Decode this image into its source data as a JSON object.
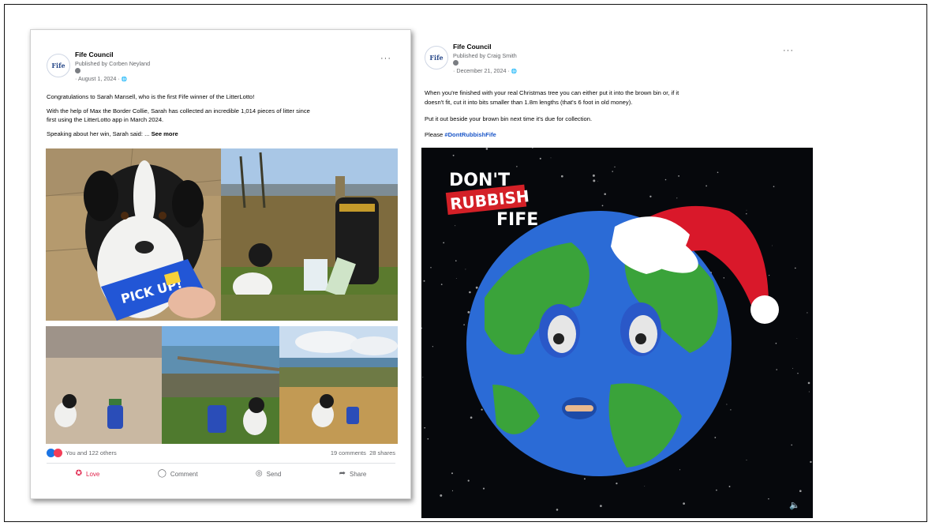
{
  "post1": {
    "page_name": "Fife Council",
    "logo_text": "Fife",
    "published_by": "Published by Corben Neyland",
    "date": "· August 1, 2024 · ",
    "globe_glyph": "🌐",
    "more_glyph": "···",
    "line1": "Congratulations to Sarah Mansell, who is the first Fife winner of the LitterLotto!",
    "line2a": "With the help of Max the Border Collie, Sarah has collected an incredible 1,014 pieces of litter since",
    "line2b": "first using the LitterLotto app in March 2024.",
    "line3": "Speaking about her win, Sarah said: ... ",
    "see_more": "See more",
    "packet_text": "PICK UP!",
    "reactions_text": "You and 122 others",
    "comments": "19 comments",
    "shares": "28 shares",
    "actions": {
      "love": "Love",
      "comment": "Comment",
      "send": "Send",
      "share": "Share"
    }
  },
  "post2": {
    "page_name": "Fife Council",
    "logo_text": "Fife",
    "published_by": "Published by Craig Smith",
    "date": "· December 21, 2024 · ",
    "globe_glyph": "🌐",
    "more_glyph": "···",
    "line1a": "When you're finished with your real Christmas tree you can either put it into the brown bin or, if it",
    "line1b": "doesn't fit, cut it into bits smaller than 1.8m lengths (that's 6 foot in old money).",
    "line2": "Put it out beside your brown bin next time it's due for collection.",
    "line3": "Please ",
    "hashtag": "#DontRubbishFife",
    "logo_dont": "DON'T",
    "logo_rubbish": "RUBBISH",
    "logo_fife": "FIFE",
    "sound_glyph": "🔈"
  },
  "colors": {
    "accent_blue": "#1b74e4",
    "love_red": "#e0234b",
    "hashtag_blue": "#1a56c8"
  }
}
